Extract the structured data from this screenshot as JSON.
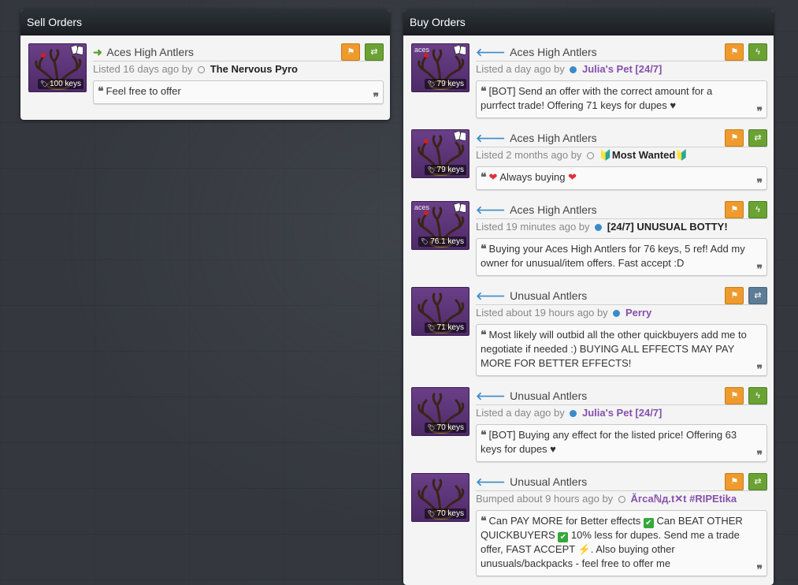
{
  "sell_orders": {
    "title": "Sell Orders",
    "listings": [
      {
        "name": "Aces High Antlers",
        "meta": "Listed 16 days ago by",
        "user": "The Nervous Pyro",
        "price": "100 keys",
        "comment": "Feel free to offer",
        "effect_label": ""
      }
    ]
  },
  "buy_orders": {
    "title": "Buy Orders",
    "listings": [
      {
        "name": "Aces High Antlers",
        "meta": "Listed a day ago by",
        "user": "Julia's Pet [24/7]",
        "price": "79 keys",
        "effect_label": "aces",
        "comment": "[BOT] Send an offer with the correct amount for a purrfect trade! Offering 71 keys for dupes ♥"
      },
      {
        "name": "Aces High Antlers",
        "meta": "Listed 2 months ago by",
        "user": "Most Wanted",
        "price": "79 keys",
        "effect_label": "",
        "comment": "Always buying"
      },
      {
        "name": "Aces High Antlers",
        "meta": "Listed 19 minutes ago by",
        "user": "[24/7] UNUSUAL BOTTY!",
        "price": "76.1 keys",
        "effect_label": "aces",
        "comment": "Buying your Aces High Antlers for 76 keys, 5 ref! Add my owner for unusual/item offers. Fast accept :D"
      },
      {
        "name": "Unusual Antlers",
        "meta": "Listed about 19 hours ago by",
        "user": "Perry",
        "price": "71 keys",
        "effect_label": "",
        "comment": "Most likely will outbid all the other quickbuyers add me to negotiate if needed :) BUYING ALL EFFECTS MAY PAY MORE FOR BETTER EFFECTS!"
      },
      {
        "name": "Unusual Antlers",
        "meta": "Listed a day ago by",
        "user": "Julia's Pet [24/7]",
        "price": "70 keys",
        "effect_label": "",
        "comment": "[BOT] Buying any effect for the listed price! Offering 63 keys for dupes ♥"
      },
      {
        "name": "Unusual Antlers",
        "meta": "Bumped about 9 hours ago by",
        "user": "Ăгсаℕд.t✕t #RIPEtika",
        "price": "70 keys",
        "effect_label": "",
        "comment_parts": [
          "Can PAY MORE for Better effects",
          "Can BEAT OTHER QUICKBUYERS",
          "10% less for dupes. Send me a trade offer, FAST ACCEPT",
          ". Also buying other unusuals/backpacks - feel free to offer me"
        ]
      }
    ]
  }
}
